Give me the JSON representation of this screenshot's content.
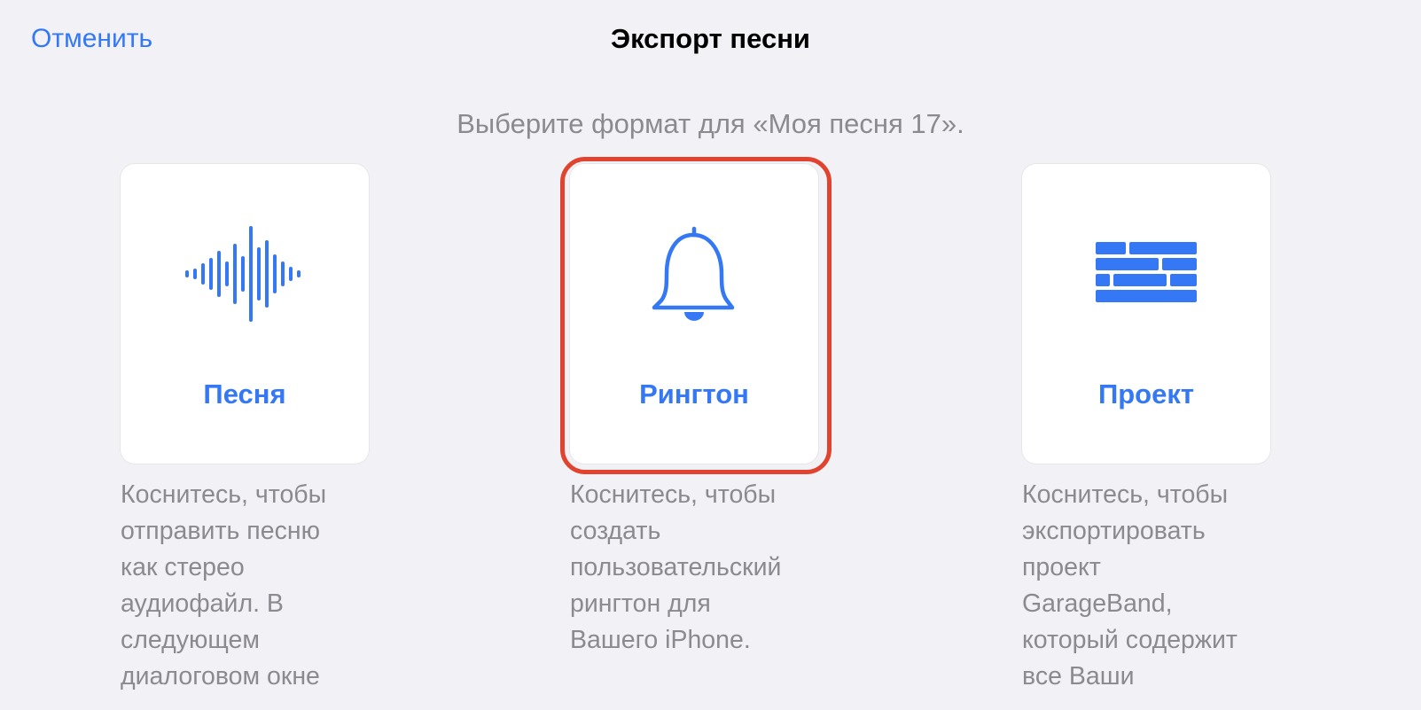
{
  "nav": {
    "cancel_label": "Отменить",
    "title": "Экспорт песни"
  },
  "subtitle": "Выберите формат для «Моя песня 17».",
  "options": [
    {
      "label": "Песня",
      "icon": "waveform-icon",
      "description": "Коснитесь, чтобы\nотправить песню\nкак стерео\nаудиофайл. В\nследующем\nдиалоговом окне"
    },
    {
      "label": "Рингтон",
      "icon": "bell-icon",
      "description": "Коснитесь, чтобы\nсоздать\nпользовательский\nрингтон для\nВашего iPhone."
    },
    {
      "label": "Проект",
      "icon": "bricks-icon",
      "description": "Коснитесь, чтобы\nэкспортировать\nпроект\nGarageBand,\nкоторый содержит\nвсе Ваши"
    }
  ],
  "colors": {
    "accent": "#3478f6",
    "highlight": "#e1432e",
    "background": "#f2f2f6",
    "secondary_text": "#8a8a8f"
  }
}
